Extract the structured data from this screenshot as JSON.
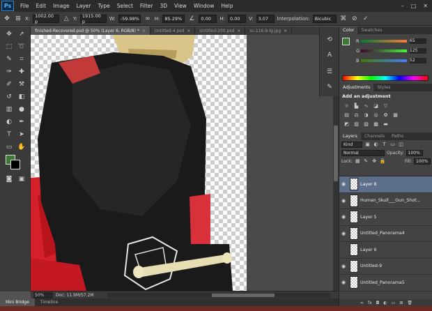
{
  "app": {
    "logo": "Ps"
  },
  "menu": [
    "File",
    "Edit",
    "Image",
    "Layer",
    "Type",
    "Select",
    "Filter",
    "3D",
    "View",
    "Window",
    "Help"
  ],
  "window_controls": {
    "minimize": "–",
    "maximize": "□",
    "close": "✕"
  },
  "options_bar": {
    "x_label": "X:",
    "x_value": "1002.00 p",
    "y_label": "Y:",
    "y_value": "1915.00 p",
    "w_label": "W:",
    "w_value": "-59.98%",
    "h_label": "H:",
    "h_value": "85.29%",
    "angle_value": "0.00",
    "hskew_label": "H:",
    "hskew_value": "0.00",
    "vskew_label": "V:",
    "vskew_value": "3.07",
    "interp_label": "Interpolation:",
    "interp_value": "Bicubic"
  },
  "tabs": [
    {
      "label": "finished-Recovered.psd @ 50% (Layer 6, RGB/8) *",
      "active": true
    },
    {
      "label": "Untitled-4.psd",
      "active": false
    },
    {
      "label": "Untitled-200.psd",
      "active": false
    },
    {
      "label": "sc-116-b-lg.jpg",
      "active": false
    }
  ],
  "status": {
    "zoom": "50%",
    "doc": "Doc: 11.9M/57.2M"
  },
  "bottom_tabs": [
    "Mini Bridge",
    "Timeline"
  ],
  "color_panel": {
    "tabs": [
      "Color",
      "Swatches"
    ],
    "r": {
      "label": "R",
      "value": "65"
    },
    "g": {
      "label": "G",
      "value": "125"
    },
    "b": {
      "label": "B",
      "value": "52"
    },
    "fg_color": "#3a7a35"
  },
  "adjustments": {
    "tabs": [
      "Adjustments",
      "Styles"
    ],
    "title": "Add an adjustment"
  },
  "layers": {
    "tabs": [
      "Layers",
      "Channels",
      "Paths"
    ],
    "kind": "Kind",
    "blend_mode": "Normal",
    "opacity_label": "Opacity:",
    "opacity_value": "100%",
    "lock_label": "Lock:",
    "fill_label": "Fill:",
    "fill_value": "100%",
    "items": [
      {
        "name": "Layer 8",
        "selected": true,
        "visible": true
      },
      {
        "name": "Human_Skull___Gun_Shot...",
        "selected": false,
        "visible": true
      },
      {
        "name": "Layer 5",
        "selected": false,
        "visible": true
      },
      {
        "name": "Untitled_Panorama4",
        "selected": false,
        "visible": true
      },
      {
        "name": "Layer 6",
        "selected": false,
        "visible": false
      },
      {
        "name": "Untitled-9",
        "selected": false,
        "visible": true
      },
      {
        "name": "Untitled_Panorama5",
        "selected": false,
        "visible": true
      },
      {
        "name": "",
        "selected": false,
        "visible": true
      }
    ]
  }
}
